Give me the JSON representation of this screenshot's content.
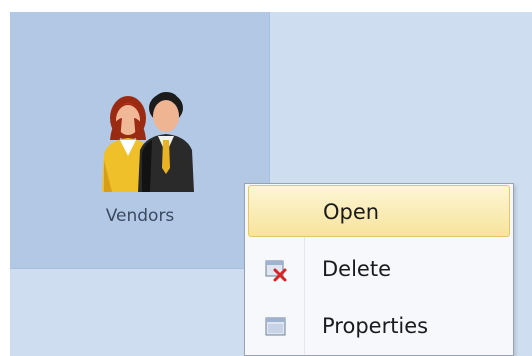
{
  "tiles": [
    {
      "label": "Vendors",
      "icon": "vendors-people-icon"
    }
  ],
  "context_menu": {
    "items": [
      {
        "label": "Open",
        "icon": "",
        "highlighted": true
      },
      {
        "label": "Delete",
        "icon": "delete-icon"
      },
      {
        "label": "Properties",
        "icon": "properties-icon"
      }
    ]
  },
  "colors": {
    "panel_bg": "#cfddf0",
    "tile_bg": "#b3c8e4",
    "menu_highlight": "#f7e39b"
  }
}
